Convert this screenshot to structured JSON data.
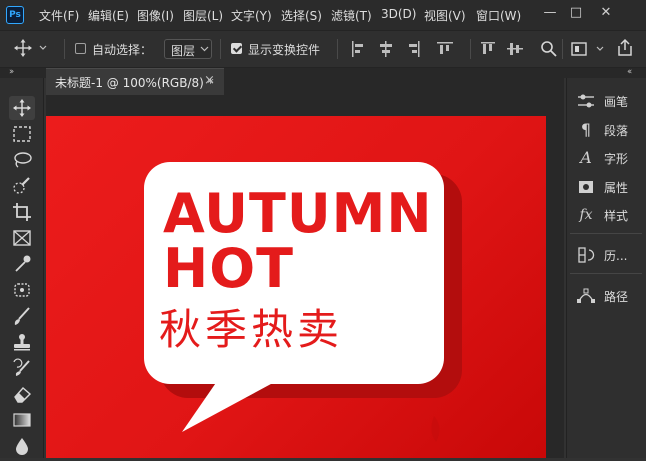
{
  "app": {
    "logo": "Ps"
  },
  "menu": [
    "文件(F)",
    "编辑(E)",
    "图像(I)",
    "图层(L)",
    "文字(Y)",
    "选择(S)",
    "滤镜(T)",
    "3D(D)",
    "视图(V)",
    "窗口(W)"
  ],
  "window_controls": {
    "minimize": "—",
    "restore": "□",
    "close": "✕"
  },
  "options": {
    "auto_select_label": "自动选择：",
    "auto_select_checked": false,
    "auto_select_target": "图层",
    "show_transform_label": "显示变换控件",
    "show_transform_checked": true
  },
  "document_tab": {
    "title": "未标题-1 @ 100%(RGB/8) *",
    "close": "×"
  },
  "canvas": {
    "headline_line1": "AUTUMN",
    "headline_line2": "HOT",
    "chinese_title": "秋季热卖"
  },
  "panels": [
    {
      "icon": "brush-settings-icon",
      "label": "画笔"
    },
    {
      "icon": "paragraph-icon",
      "label": "段落"
    },
    {
      "icon": "character-icon",
      "label": "字形"
    },
    {
      "icon": "properties-icon",
      "label": "属性"
    },
    {
      "icon": "styles-icon",
      "label": "样式"
    },
    {
      "icon": "history-icon",
      "label": "历..."
    },
    {
      "icon": "paths-icon",
      "label": "路径"
    }
  ],
  "colors": {
    "accent": "#31a8ff",
    "canvas_red": "#e41b1b",
    "bubble": "#ffffff"
  }
}
